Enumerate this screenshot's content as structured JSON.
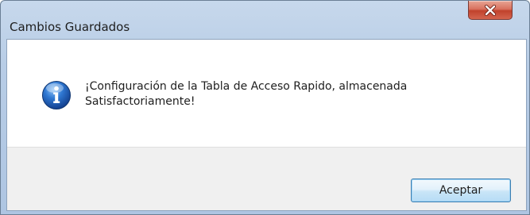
{
  "window": {
    "title": "Cambios Guardados"
  },
  "message": {
    "text": "¡Configuración de la Tabla de Acceso Rapido, almacenada Satisfactoriamente!",
    "icon": "info-icon"
  },
  "buttons": {
    "ok_label": "Aceptar",
    "close_icon": "close-icon"
  },
  "colors": {
    "close_button": "#c7503b",
    "button_border": "#3c7fb1",
    "info_icon": "#1e5db5"
  }
}
